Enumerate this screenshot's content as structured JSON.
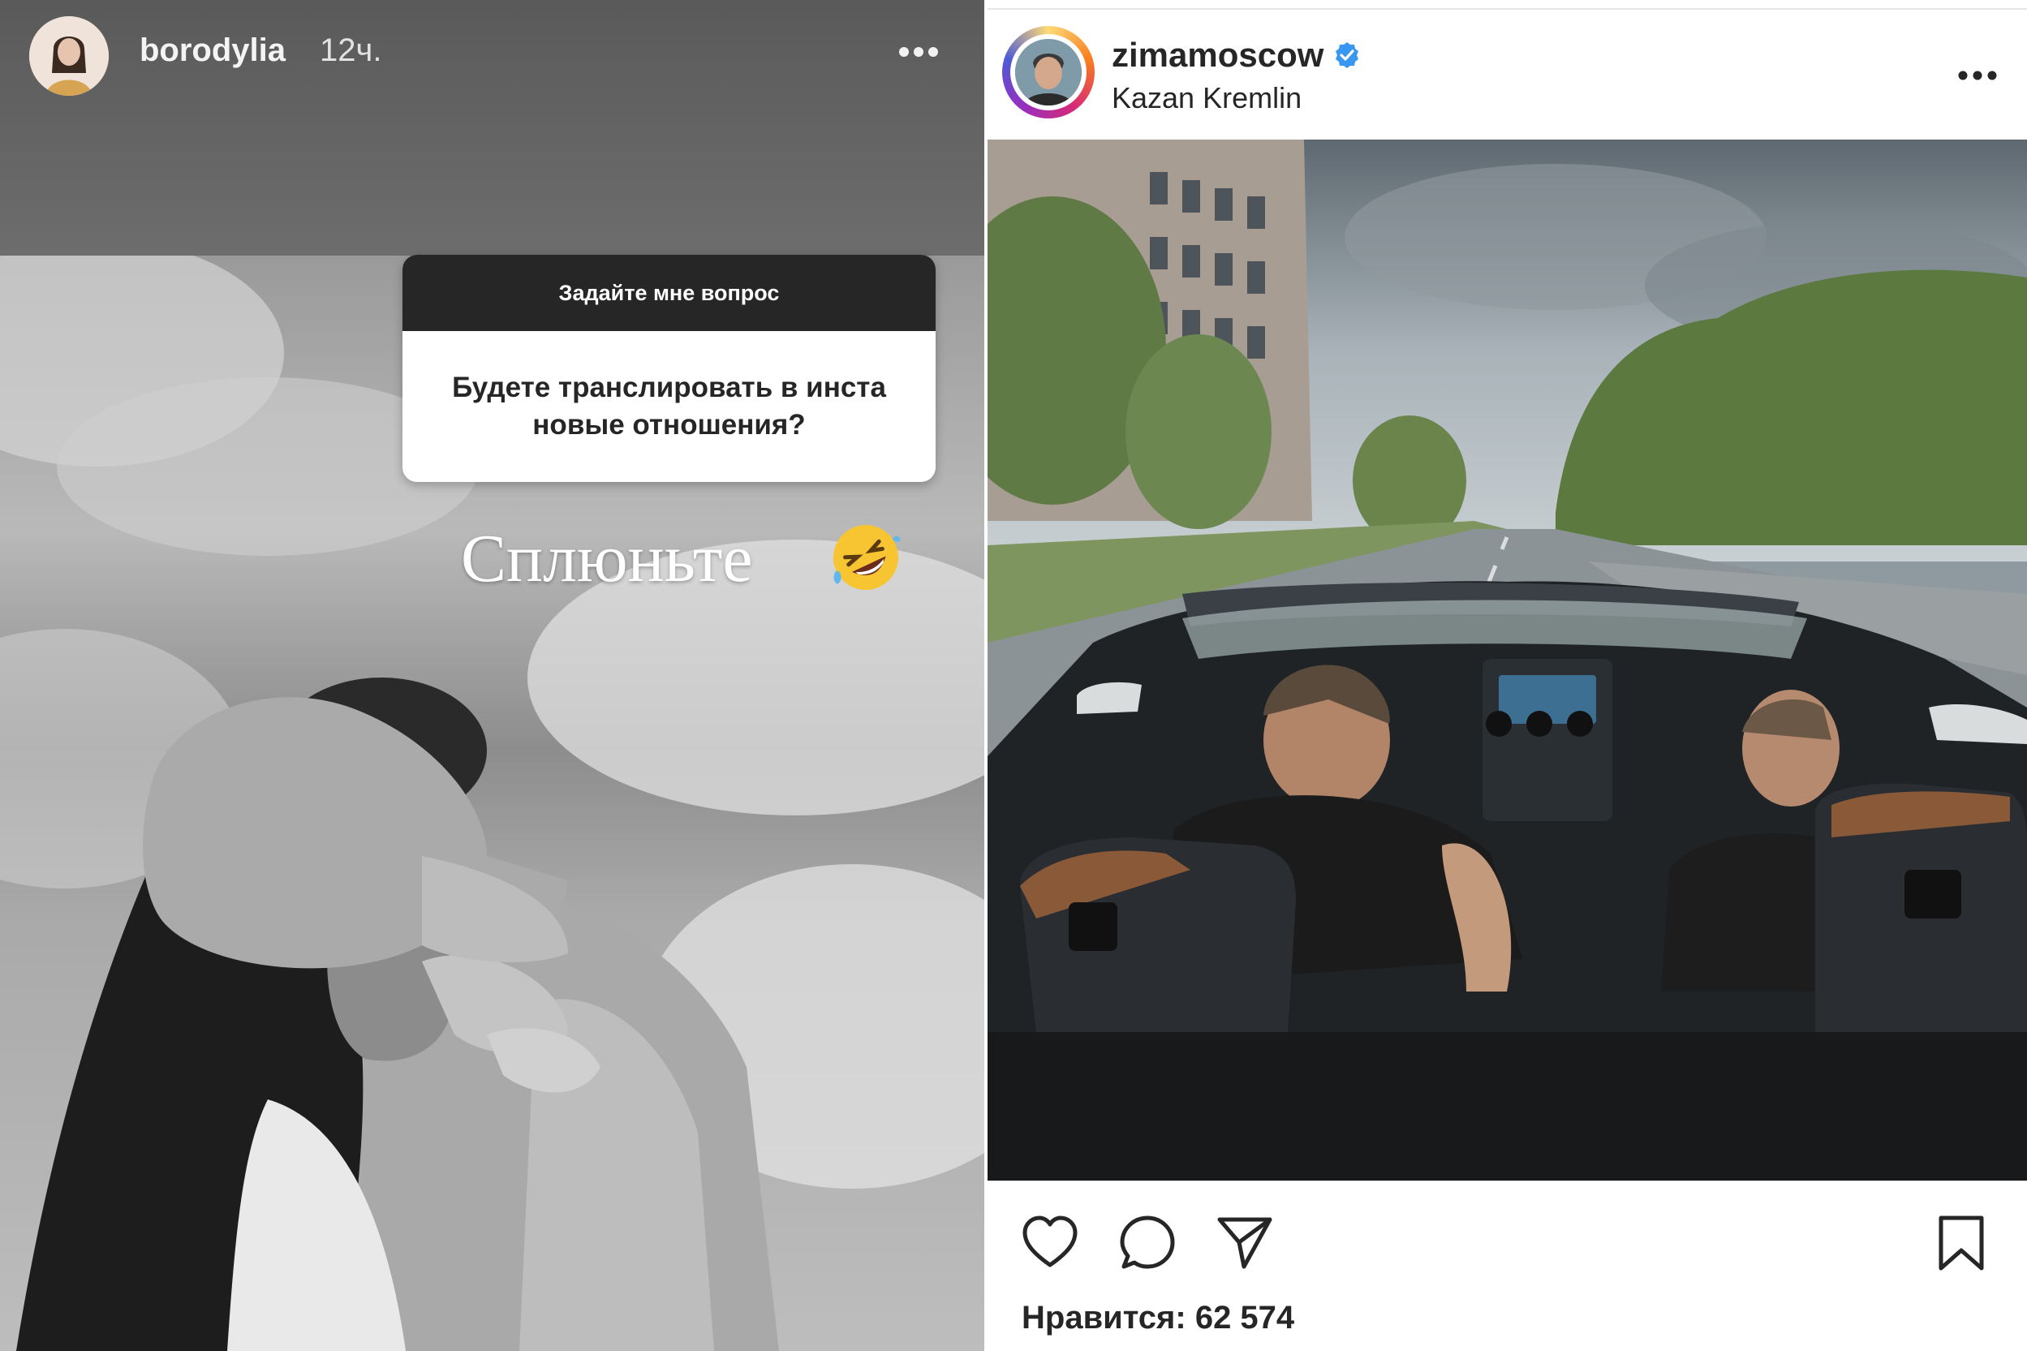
{
  "story": {
    "username": "borodylia",
    "time": "12ч.",
    "question_header": "Задайте мне вопрос",
    "question_text": "Будете транслировать в инста новые отношения?",
    "caption": "Сплюньте",
    "emoji": "rofl-emoji-icon",
    "more_icon": "more-horizontal-icon"
  },
  "post": {
    "username": "zimamoscow",
    "verified": true,
    "location": "Kazan Kremlin",
    "more_icon": "more-horizontal-icon",
    "actions": [
      "heart-icon",
      "comment-icon",
      "share-icon",
      "bookmark-icon"
    ],
    "likes_label": "Нравится:",
    "likes_count": "62 574",
    "likes_text": "Нравится: 62 574"
  },
  "colors": {
    "text_dark": "#262626",
    "verified_blue": "#3897f0",
    "question_header_bg": "#262626"
  }
}
